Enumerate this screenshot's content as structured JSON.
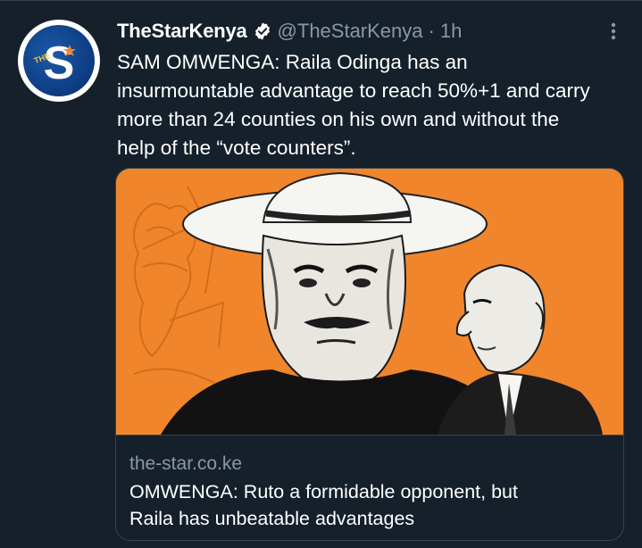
{
  "tweet": {
    "display_name": "TheStarKenya",
    "handle": "@TheStarKenya",
    "separator": "·",
    "time": "1h",
    "text": "SAM OMWENGA: Raila Odinga has an\ninsurmountable advantage to reach 50%+1 and carry\nmore than 24 counties on his own and without the\nhelp of the “vote counters”.",
    "avatar_letter": "S",
    "avatar_small_text": "THE",
    "avatar_icon": "thestar-logo",
    "verified_icon": "verified-badge-icon",
    "more_icon": "more-vertical-icon"
  },
  "card": {
    "domain": "the-star.co.ke",
    "title": "OMWENGA: Ruto a formidable opponent, but\nRaila has unbeatable advantages",
    "image_description_icon": "illustration-icon"
  },
  "colors": {
    "background": "#15202b",
    "border": "#38444d",
    "secondary_text": "#8899a6",
    "card_orange": "#f0852b",
    "avatar_blue": "#0f3f86"
  }
}
